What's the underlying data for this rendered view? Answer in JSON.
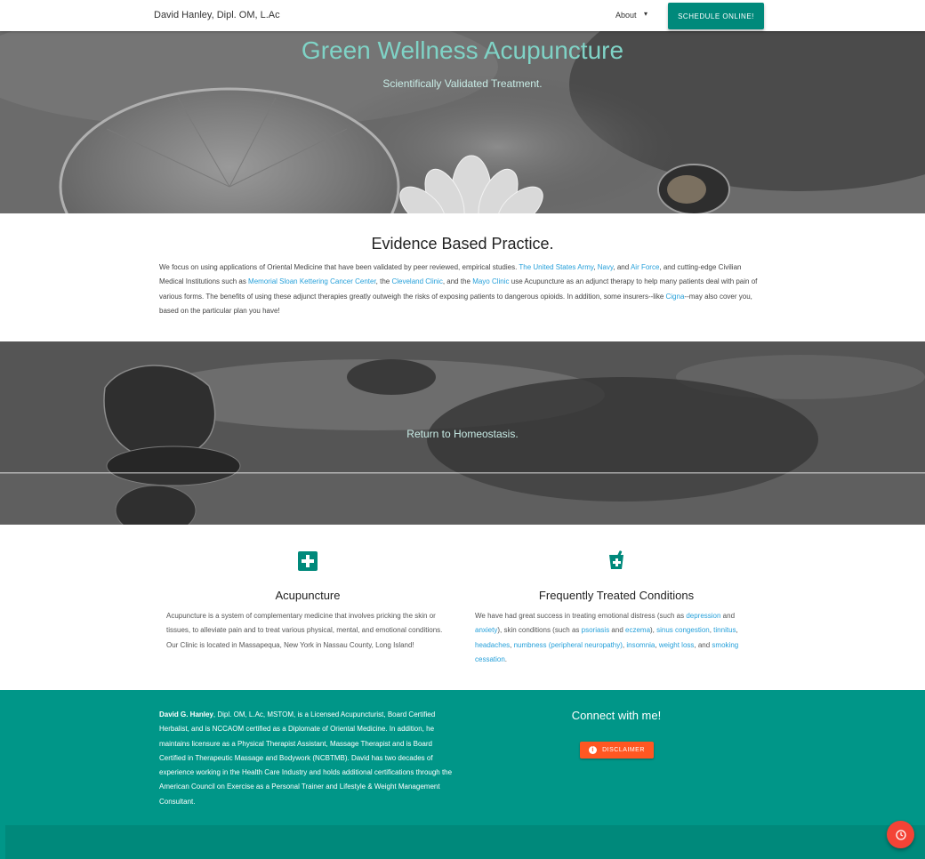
{
  "nav": {
    "brand": "David Hanley, Dipl. OM, L.Ac",
    "about_label": "About",
    "schedule_label": "SCHEDULE ONLINE!"
  },
  "hero": {
    "title": "Green Wellness Acupuncture",
    "subtitle": "Scientifically Validated Treatment."
  },
  "evidence": {
    "title": "Evidence Based Practice.",
    "p1": "We focus on using applications of Oriental Medicine that have been validated by peer reviewed, empirical studies. ",
    "link_army": "The United States Army",
    "sep1": ", ",
    "link_navy": "Navy",
    "sep2": ", and ",
    "link_airforce": "Air Force",
    "p2": ", and cutting-edge Civilian Medical Institutions such as ",
    "link_msk": "Memorial Sloan Kettering Cancer Center",
    "sep3": ", the ",
    "link_cleveland": "Cleveland Clinic",
    "sep4": ", and the ",
    "link_mayo": "Mayo Clinic",
    "p3": " use Acupuncture as an adjunct therapy to help many patients deal with pain of various forms. The benefits of using these adjunct therapies greatly outweigh the risks of exposing patients to dangerous opioids. In addition, some insurers--like ",
    "link_cigna": "Cigna",
    "p4": "--may also cover you, based on the particular plan you have!"
  },
  "banner": {
    "text": "Return to Homeostasis."
  },
  "features": {
    "acupuncture": {
      "title": "Acupuncture",
      "text": "Acupuncture is a system of complementary medicine that involves pricking the skin or tissues, to alleviate pain and to treat various physical, mental, and emotional conditions. Our Clinic is located in Massapequa, New York  in Nassau County, Long Island!"
    },
    "conditions": {
      "title": "Frequently Treated Conditions",
      "t1": "We have had great success in treating emotional distress (such as ",
      "l_depression": "depression",
      "t2": " and ",
      "l_anxiety": "anxiety",
      "t3": "), skin conditions (such as ",
      "l_psoriasis": "psoriasis",
      "t4": " and ",
      "l_eczema": "eczema",
      "t5": "), ",
      "l_sinus": "sinus congestion",
      "t6": ", ",
      "l_tinnitus": "tinnitus",
      "t7": ", ",
      "l_headaches": "headaches",
      "t8": ", ",
      "l_numbness": "numbness (peripheral neuropathy)",
      "t9": ", ",
      "l_insomnia": "insomnia",
      "t10": ", ",
      "l_weight": "weight loss",
      "t11": ", and ",
      "l_smoking": "smoking cessation",
      "t12": "."
    }
  },
  "footer": {
    "bio_name": "David G. Hanley",
    "bio_text": ", Dipl. OM, L.Ac, MSTOM, is a Licensed Acupuncturist, Board Certified Herbalist, and is NCCAOM certified as a Diplomate of Oriental Medicine. In addition, he maintains licensure as a Physical Therapist Assistant, Massage Therapist and is Board Certified in Therapeutic Massage and Bodywork (NCBTMB). David has two decades of experience working in the Health Care Industry and holds additional certifications through the American Council on Exercise as a Personal Trainer and Lifestyle & Weight Management Consultant.",
    "connect": "Connect with me!",
    "disclaimer_label": "DISCLAIMER"
  },
  "colors": {
    "accent": "#00897b",
    "footer": "#009688",
    "hero_title": "#7fd3c6",
    "disclaimer": "#ff5722",
    "fab": "#f44336",
    "link": "#26a0da"
  },
  "icons": {
    "about_chevron": "caret-down-icon",
    "acupuncture": "medical-cross-icon",
    "conditions": "mortar-pestle-icon",
    "disclaimer": "info-icon",
    "fab": "clock-icon"
  }
}
